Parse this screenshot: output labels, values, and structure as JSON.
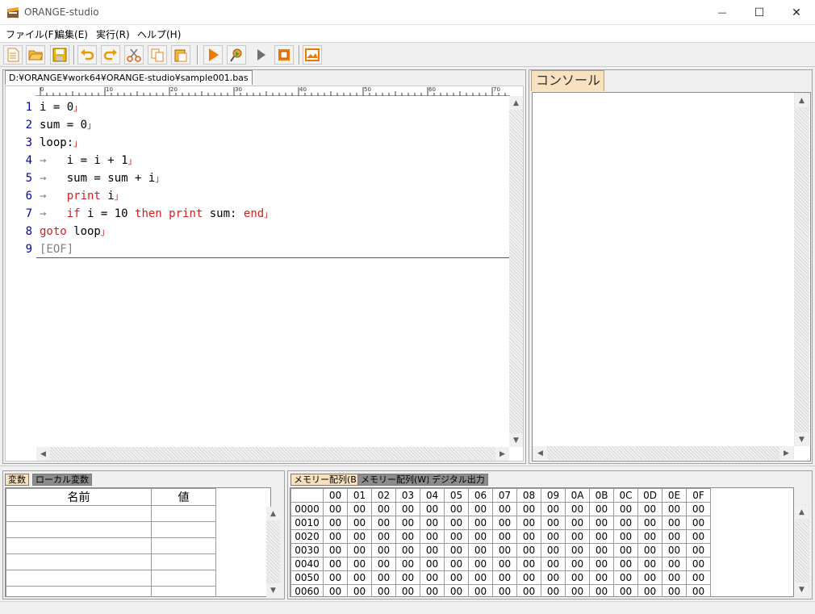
{
  "window": {
    "title": "ORANGE-studio",
    "minimize_glyph": "—",
    "maximize_glyph": "☐",
    "close_glyph": "✕"
  },
  "menu": [
    {
      "label": "ファイル(F)"
    },
    {
      "label": "編集(E)"
    },
    {
      "label": "実行(R)"
    },
    {
      "label": "ヘルプ(H)"
    }
  ],
  "toolbar": {
    "buttons": [
      "new-file-icon",
      "open-folder-icon",
      "save-icon",
      "undo-icon",
      "redo-icon",
      "cut-icon",
      "copy-icon",
      "paste-icon",
      "run-icon",
      "debug-icon",
      "step-icon",
      "stop-icon",
      "graphics-window-icon"
    ]
  },
  "editor": {
    "tab_label": "D:¥ORANGE¥work64¥ORANGE-studio¥sample001.bas",
    "ruler_labels": [
      "0",
      "10",
      "20",
      "30",
      "40",
      "50",
      "60",
      "70"
    ],
    "lines": [
      {
        "num": "1",
        "segments": [
          {
            "t": "i = 0",
            "kw": false
          }
        ],
        "eol": "」"
      },
      {
        "num": "2",
        "segments": [
          {
            "t": "sum = 0",
            "kw": false
          }
        ],
        "eol": "」"
      },
      {
        "num": "3",
        "segments": [
          {
            "t": "loop:",
            "kw": false
          }
        ],
        "eol": "」"
      },
      {
        "num": "4",
        "segments": [
          {
            "t": "→   ",
            "kw": false
          },
          {
            "t": "i = i + 1",
            "kw": false
          }
        ],
        "eol": "」"
      },
      {
        "num": "5",
        "segments": [
          {
            "t": "→   ",
            "kw": false
          },
          {
            "t": "sum = sum + i",
            "kw": false
          }
        ],
        "eol": "」"
      },
      {
        "num": "6",
        "segments": [
          {
            "t": "→   ",
            "kw": false
          },
          {
            "t": "print",
            "kw": true
          },
          {
            "t": " i",
            "kw": false
          }
        ],
        "eol": "」"
      },
      {
        "num": "7",
        "segments": [
          {
            "t": "→   ",
            "kw": false
          },
          {
            "t": "if",
            "kw": true
          },
          {
            "t": " i = 10 ",
            "kw": false
          },
          {
            "t": "then print",
            "kw": true
          },
          {
            "t": " sum: ",
            "kw": false
          },
          {
            "t": "end",
            "kw": true
          }
        ],
        "eol": "」"
      },
      {
        "num": "8",
        "segments": [
          {
            "t": "goto",
            "kw": true
          },
          {
            "t": " loop",
            "kw": false
          }
        ],
        "eol": "」"
      },
      {
        "num": "9",
        "segments": [
          {
            "t": "[EOF]",
            "kw": false
          }
        ],
        "eol": ""
      }
    ]
  },
  "console": {
    "tab_label": "コンソール"
  },
  "variables": {
    "tabs": [
      {
        "label": "変数"
      },
      {
        "label": "ローカル変数"
      }
    ],
    "headers": {
      "name": "名前",
      "value": "値"
    },
    "row_count": 6
  },
  "memory": {
    "tabs": [
      {
        "label": "メモリー配列(B)"
      },
      {
        "label": "メモリー配列(W)"
      },
      {
        "label": "デジタル出力"
      }
    ],
    "columns": [
      "00",
      "01",
      "02",
      "03",
      "04",
      "05",
      "06",
      "07",
      "08",
      "09",
      "0A",
      "0B",
      "0C",
      "0D",
      "0E",
      "0F"
    ],
    "rows": [
      "0000",
      "0010",
      "0020",
      "0030",
      "0040",
      "0050",
      "0060"
    ],
    "cell_value": "00"
  },
  "colors": {
    "keyword": "#d02020",
    "line_number": "#0000aa",
    "console_tab": "#f8e1bf",
    "active_subtab": "#f8e1bf",
    "inactive_subtab": "#8c8c8c"
  }
}
